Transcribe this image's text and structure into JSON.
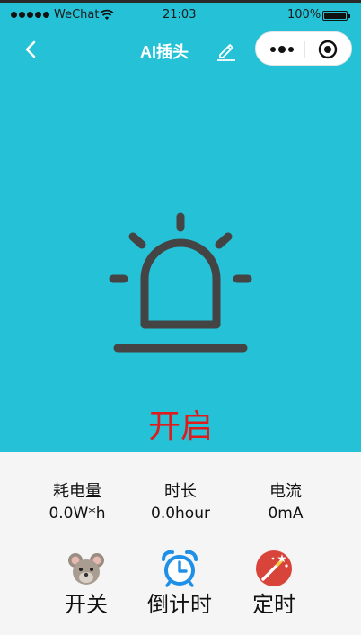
{
  "status_bar": {
    "carrier": "WeChat",
    "time": "21:03",
    "battery_percent": "100%"
  },
  "nav": {
    "title": "AI插头",
    "back_icon": "chevron-left-icon",
    "edit_icon": "pencil-icon"
  },
  "device": {
    "state_label": "开启",
    "state_color": "#e01b1b",
    "icon": "alarm-lamp-icon"
  },
  "stats": [
    {
      "label": "耗电量",
      "value": "0.0W*h"
    },
    {
      "label": "时长",
      "value": "0.0hour"
    },
    {
      "label": "电流",
      "value": "0mA"
    }
  ],
  "actions": [
    {
      "label": "开关",
      "icon": "mouse-icon"
    },
    {
      "label": "倒计时",
      "icon": "alarm-clock-icon"
    },
    {
      "label": "定时",
      "icon": "magic-wand-icon"
    }
  ],
  "colors": {
    "header_bg": "#25c1d6",
    "panel_bg": "#f5f5f5",
    "accent_red": "#e01b1b"
  }
}
